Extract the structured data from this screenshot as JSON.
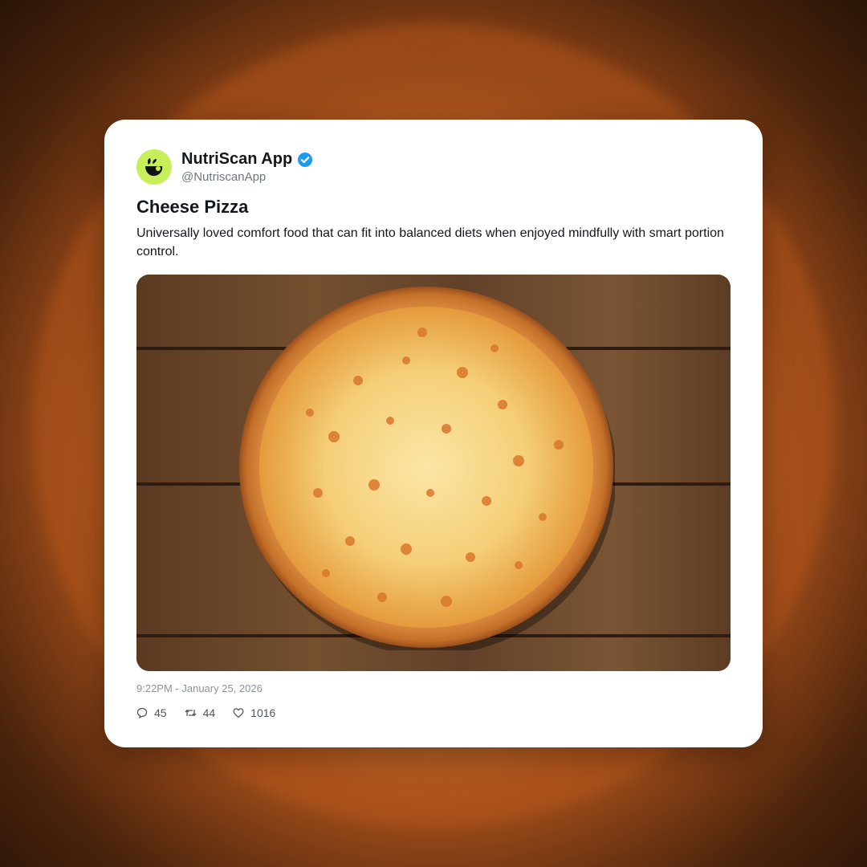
{
  "post": {
    "display_name": "NutriScan App",
    "handle": "@NutriscanApp",
    "verified_icon": "verified-badge-icon",
    "avatar_icon": "nutriscan-logo-icon",
    "title": "Cheese Pizza",
    "description": "Universally loved comfort food that can fit into balanced diets when enjoyed mindfully with smart portion control.",
    "image_subject": "cheese-pizza-photo",
    "timestamp": "9:22PM - January 25, 2026",
    "stats": {
      "replies": "45",
      "reposts": "44",
      "likes": "1016"
    }
  },
  "colors": {
    "avatar_bg": "#c7ef5a",
    "verified": "#1d9bf0",
    "card_bg": "#ffffff",
    "background": "#a8521c"
  }
}
